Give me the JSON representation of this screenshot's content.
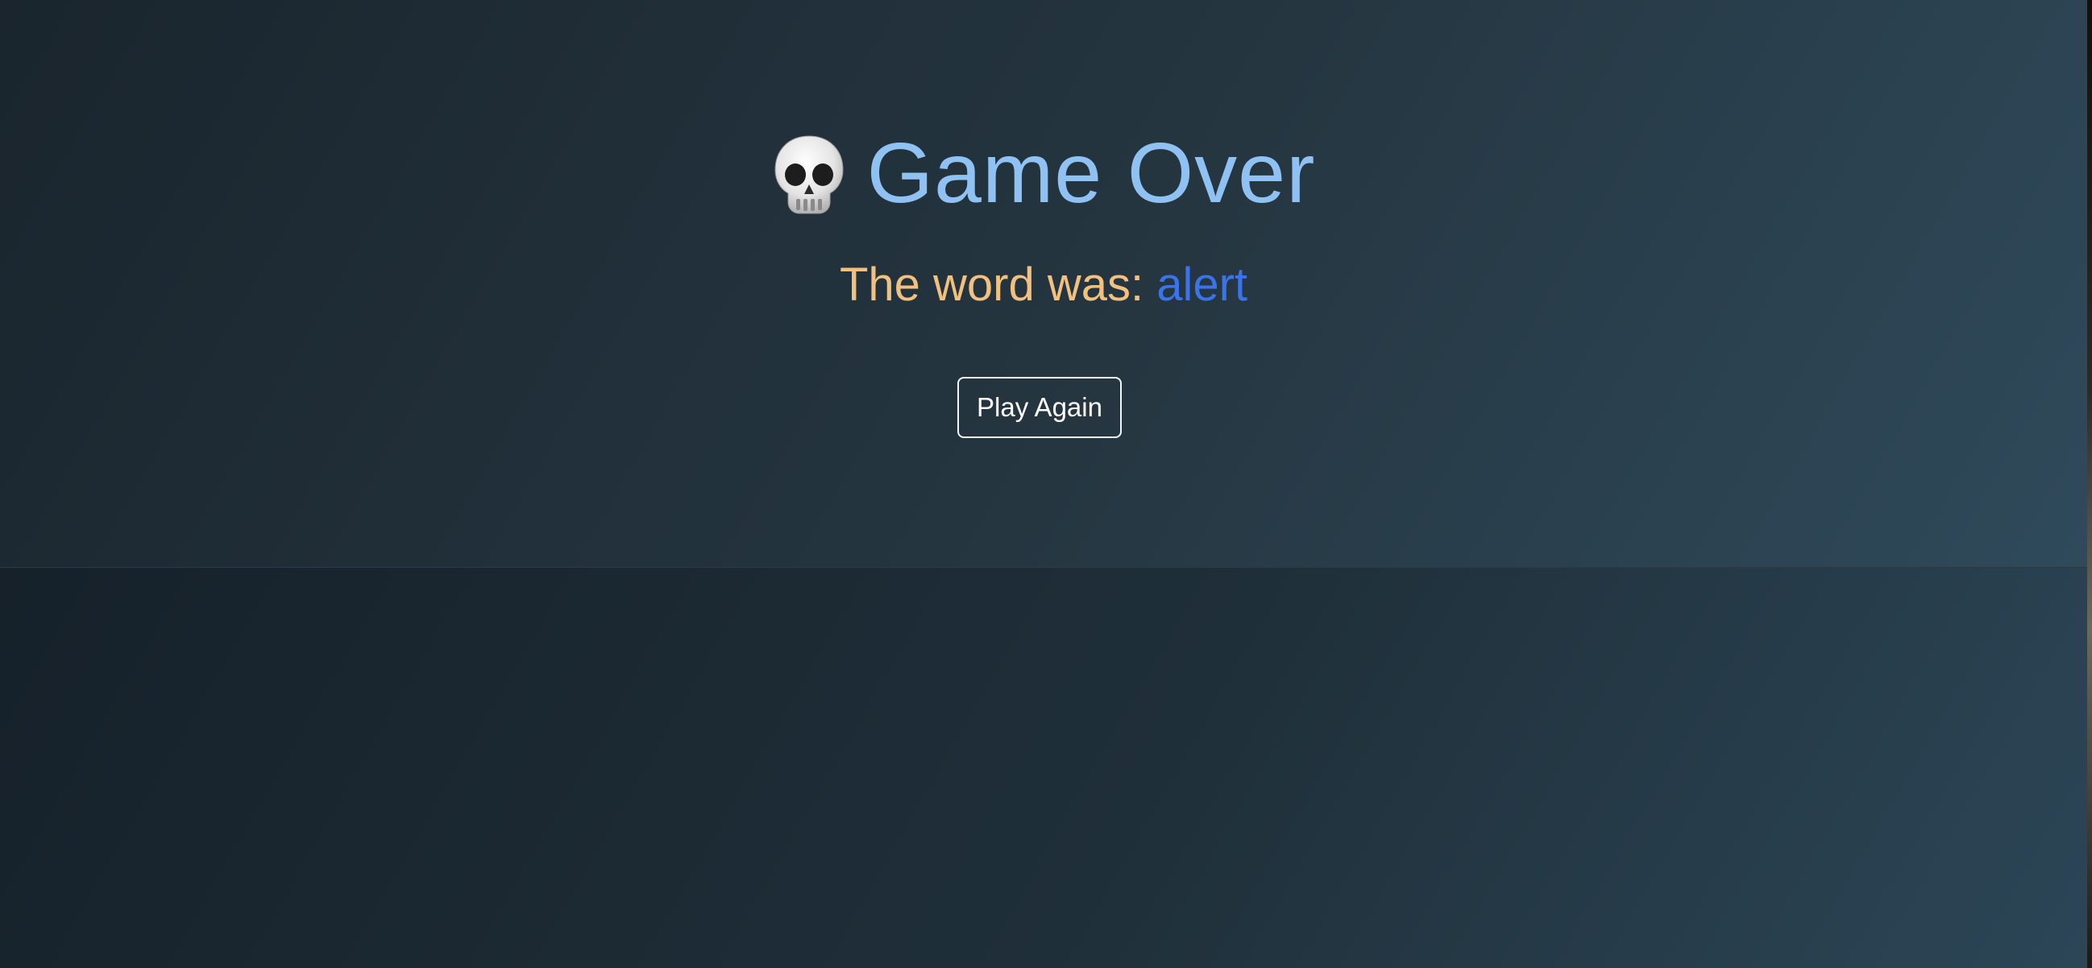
{
  "game_over": {
    "icon": "skull-icon",
    "title": "Game Over",
    "word_prefix": "The word was: ",
    "word": "alert",
    "play_again_label": "Play Again"
  },
  "colors": {
    "title": "#8fc1f2",
    "prefix": "#f2c07f",
    "word": "#3b74ea",
    "button_border": "#f2f5f8"
  }
}
